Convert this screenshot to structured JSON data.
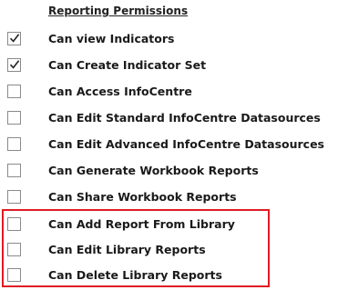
{
  "section": {
    "title": "Reporting Permissions"
  },
  "permissions": [
    {
      "label": "Can view Indicators",
      "checked": true
    },
    {
      "label": "Can Create Indicator Set",
      "checked": true
    },
    {
      "label": "Can Access InfoCentre",
      "checked": false
    },
    {
      "label": "Can Edit Standard InfoCentre Datasources",
      "checked": false
    },
    {
      "label": "Can Edit Advanced InfoCentre Datasources",
      "checked": false
    },
    {
      "label": "Can Generate Workbook Reports",
      "checked": false
    },
    {
      "label": "Can Share Workbook Reports",
      "checked": false
    },
    {
      "label": "Can Add Report From Library",
      "checked": false
    },
    {
      "label": "Can Edit Library Reports",
      "checked": false
    },
    {
      "label": "Can Delete Library Reports",
      "checked": false
    }
  ],
  "colors": {
    "highlight": "#e01b24",
    "checkbox_border": "#8a8a8a"
  },
  "icons": {
    "checked": "checkmark-icon"
  }
}
